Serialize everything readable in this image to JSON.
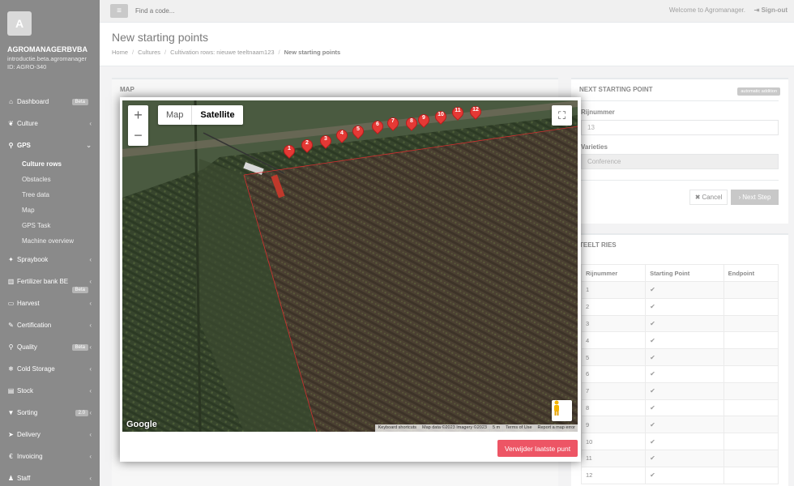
{
  "sidebar": {
    "avatar_letter": "A",
    "company": "AGROMANAGERBVBA",
    "company_sub1": "introductie.beta.agromanager",
    "company_sub2": "ID: AGRO-340",
    "items": [
      {
        "label": "Dashboard",
        "icon": "home-icon",
        "badge": "Beta"
      },
      {
        "label": "Culture",
        "icon": "leaf-icon"
      },
      {
        "label": "GPS",
        "icon": "map-marker-icon"
      },
      {
        "label": "Spraybook",
        "icon": "spray-icon"
      },
      {
        "label": "Fertilizer bank BE",
        "icon": "flask-icon",
        "badge": "Beta"
      },
      {
        "label": "Harvest",
        "icon": "basket-icon"
      },
      {
        "label": "Certification",
        "icon": "certificate-icon"
      },
      {
        "label": "Quality",
        "icon": "search-icon",
        "badge": "Beta"
      },
      {
        "label": "Cold Storage",
        "icon": "snowflake-icon"
      },
      {
        "label": "Stock",
        "icon": "box-icon"
      },
      {
        "label": "Sorting",
        "icon": "filter-icon",
        "badge": "2.0"
      },
      {
        "label": "Delivery",
        "icon": "truck-icon"
      },
      {
        "label": "Invoicing",
        "icon": "euro-icon"
      },
      {
        "label": "Staff",
        "icon": "user-icon"
      }
    ],
    "gps_sub": [
      "Culture rows",
      "Obstacles",
      "Tree data",
      "Map",
      "GPS Task",
      "Machine overview"
    ]
  },
  "topbar": {
    "search_placeholder": "Find a code...",
    "welcome": "Welcome to Agromanager.",
    "signout": "Sign-out"
  },
  "heading": {
    "title": "New starting points",
    "breadcrumb": [
      "Home",
      "Cultures",
      "Cultivation rows: nieuwe teeltnaam123",
      "New starting points"
    ]
  },
  "map_panel": {
    "title": "MAP"
  },
  "map": {
    "type_options": [
      "Map",
      "Satellite"
    ],
    "selected_type": "Satellite",
    "google": "Google",
    "attribution": [
      "Keyboard shortcuts",
      "Map data ©2023 Imagery ©2023",
      "5 m",
      "Terms of Use",
      "Report a map error"
    ],
    "markers": [
      "1",
      "2",
      "3",
      "4",
      "5",
      "6",
      "7",
      "8",
      "9",
      "10",
      "11",
      "12"
    ],
    "remove_button": "Verwijder laatste punt",
    "colors": {
      "marker": "#e53935",
      "remove_button": "#ed5565",
      "boundary": "#d32f2f"
    }
  },
  "next_point": {
    "title": "NEXT STARTING POINT",
    "badge": "automatic addition",
    "row_label": "Rijnummer",
    "row_value": "13",
    "varieties_label": "Varieties",
    "varieties_value": "Conference",
    "cancel": "Cancel",
    "next": "Next Step"
  },
  "rows_table": {
    "title": "TEELT RIES",
    "headers": [
      "Rijnummer",
      "Starting Point",
      "Endpoint"
    ],
    "rows": [
      {
        "n": "1",
        "start": true
      },
      {
        "n": "2",
        "start": true
      },
      {
        "n": "3",
        "start": true
      },
      {
        "n": "4",
        "start": true
      },
      {
        "n": "5",
        "start": true
      },
      {
        "n": "6",
        "start": true
      },
      {
        "n": "7",
        "start": true
      },
      {
        "n": "8",
        "start": true
      },
      {
        "n": "9",
        "start": true
      },
      {
        "n": "10",
        "start": true
      },
      {
        "n": "11",
        "start": true
      },
      {
        "n": "12",
        "start": true
      }
    ]
  }
}
